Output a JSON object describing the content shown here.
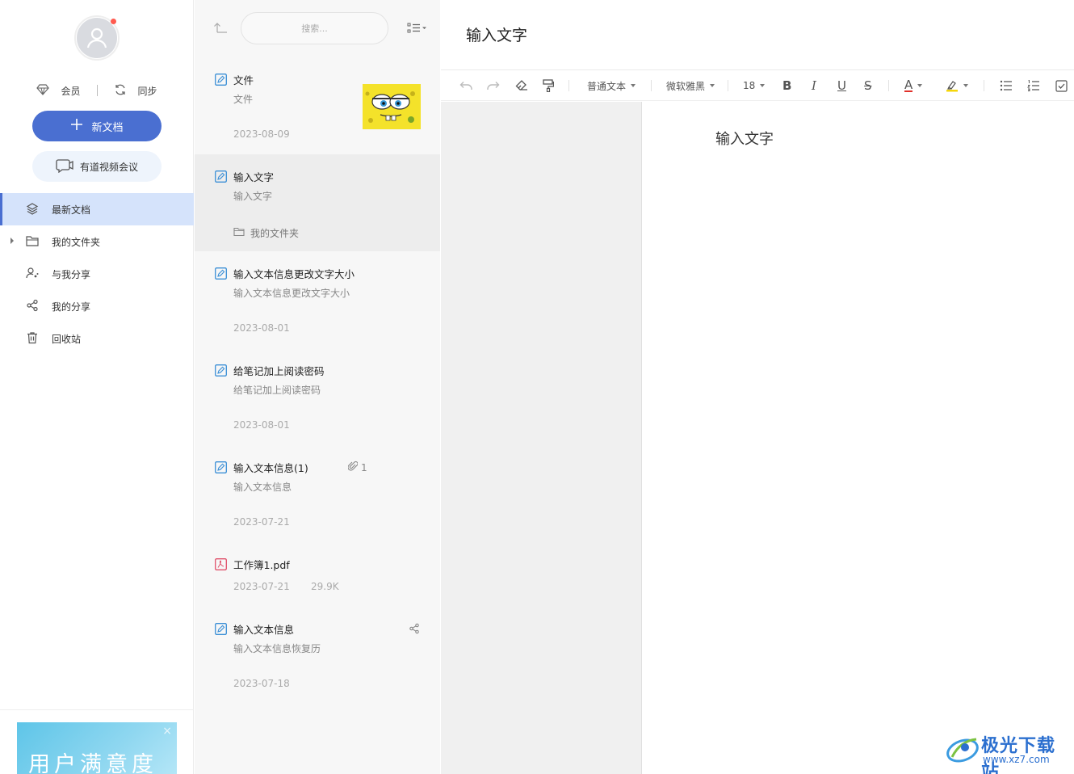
{
  "sidebar": {
    "member_label": "会员",
    "sync_label": "同步",
    "new_doc_label": "新文档",
    "meeting_label": "有道视频会议",
    "nav": [
      {
        "label": "最新文档",
        "icon": "layers-icon",
        "active": true
      },
      {
        "label": "我的文件夹",
        "icon": "folder-icon",
        "active": false
      },
      {
        "label": "与我分享",
        "icon": "shared-with-me-icon",
        "active": false
      },
      {
        "label": "我的分享",
        "icon": "share-icon",
        "active": false
      },
      {
        "label": "回收站",
        "icon": "trash-icon",
        "active": false
      }
    ],
    "banner_text": "用户满意度",
    "banner_close": "×"
  },
  "list": {
    "search_placeholder": "搜索...",
    "docs": [
      {
        "title": "文件",
        "subtitle": "文件",
        "date": "2023-08-09"
      },
      {
        "title": "输入文字",
        "subtitle": "输入文字",
        "folder": "我的文件夹"
      },
      {
        "title": "输入文本信息更改文字大小",
        "subtitle": "输入文本信息更改文字大小",
        "date": "2023-08-01"
      },
      {
        "title": "给笔记加上阅读密码",
        "subtitle": "给笔记加上阅读密码",
        "date": "2023-08-01"
      },
      {
        "title": "输入文本信息(1)",
        "subtitle": "输入文本信息",
        "date": "2023-07-21",
        "attachments": "1"
      },
      {
        "title": "工作簿1.pdf",
        "date": "2023-07-21",
        "size": "29.9K"
      },
      {
        "title": "输入文本信息",
        "subtitle": "输入文本信息恢复历",
        "date": "2023-07-18"
      }
    ]
  },
  "editor": {
    "title": "输入文字",
    "toolbar": {
      "paragraph_style": "普通文本",
      "font": "微软雅黑",
      "font_size": "18",
      "bold": "B",
      "italic": "I",
      "underline": "U",
      "strike": "S",
      "font_color": "A"
    },
    "content": "输入文字"
  },
  "watermark": {
    "title": "极光下载站",
    "url": "www.xz7.com"
  },
  "colors": {
    "accent": "#4a6fd1",
    "active_nav_bg": "#d5e3fb",
    "doc_icon": "#3b8fd6",
    "pdf_icon": "#e0506a"
  }
}
